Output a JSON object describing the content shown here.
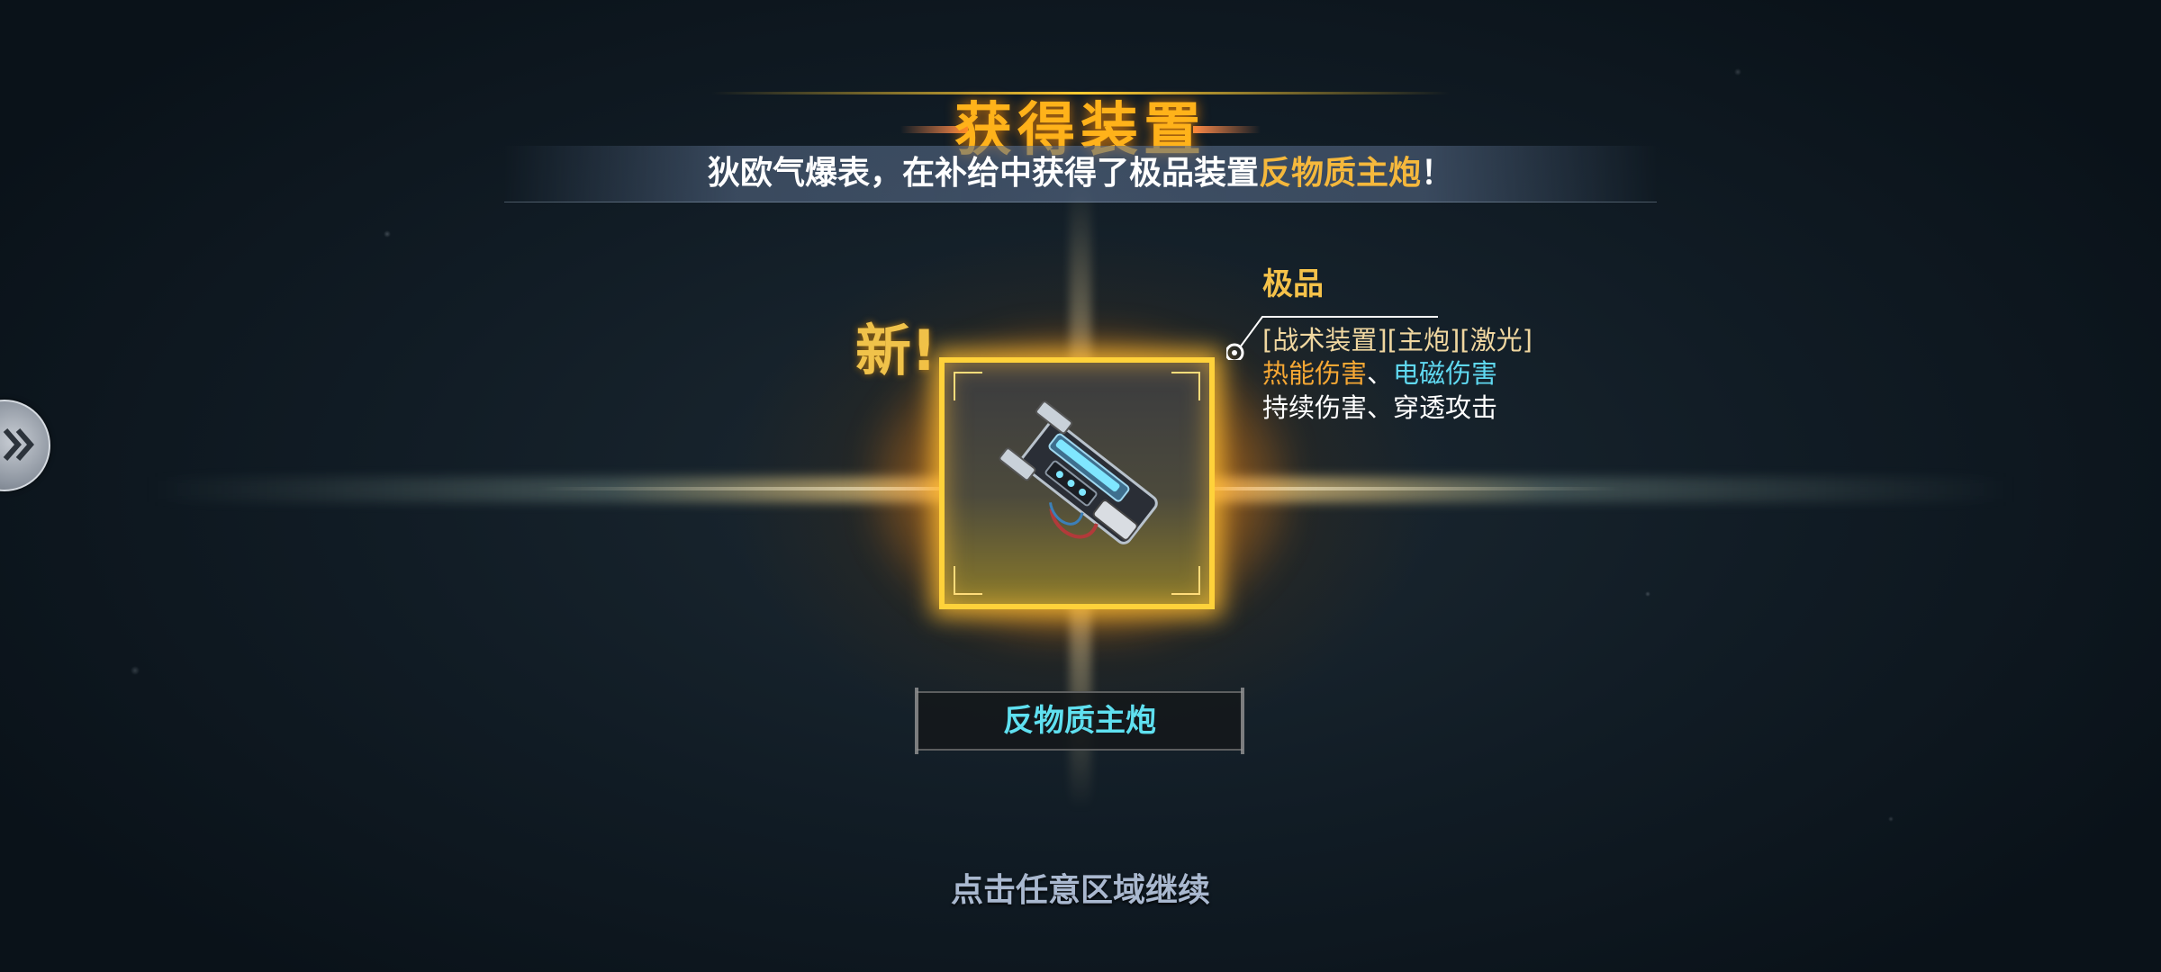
{
  "popup": {
    "title": "获得装置",
    "announcement": {
      "prefix": "狄欧气爆表，在补给中获得了极品装置",
      "item": "反物质主炮",
      "suffix": "！"
    },
    "new_label": "新!",
    "item": {
      "grade": "极品",
      "tags": "[战术装置][主炮][激光]",
      "damage_type_1": "热能伤害",
      "separator": "、",
      "damage_type_2": "电磁伤害",
      "effects": "持续伤害、穿透攻击",
      "name": "反物质主炮",
      "icon": "antimatter-cannon-icon"
    },
    "continue_hint": "点击任意区域继续"
  },
  "side_tab": {
    "icon": "double-chevron-right-icon"
  },
  "colors": {
    "gold": "#f5c24a",
    "title_orange": "#ffb21a",
    "item_highlight": "#f5b83c",
    "cyan": "#5fe0f0",
    "hint": "#a9b8cf"
  }
}
